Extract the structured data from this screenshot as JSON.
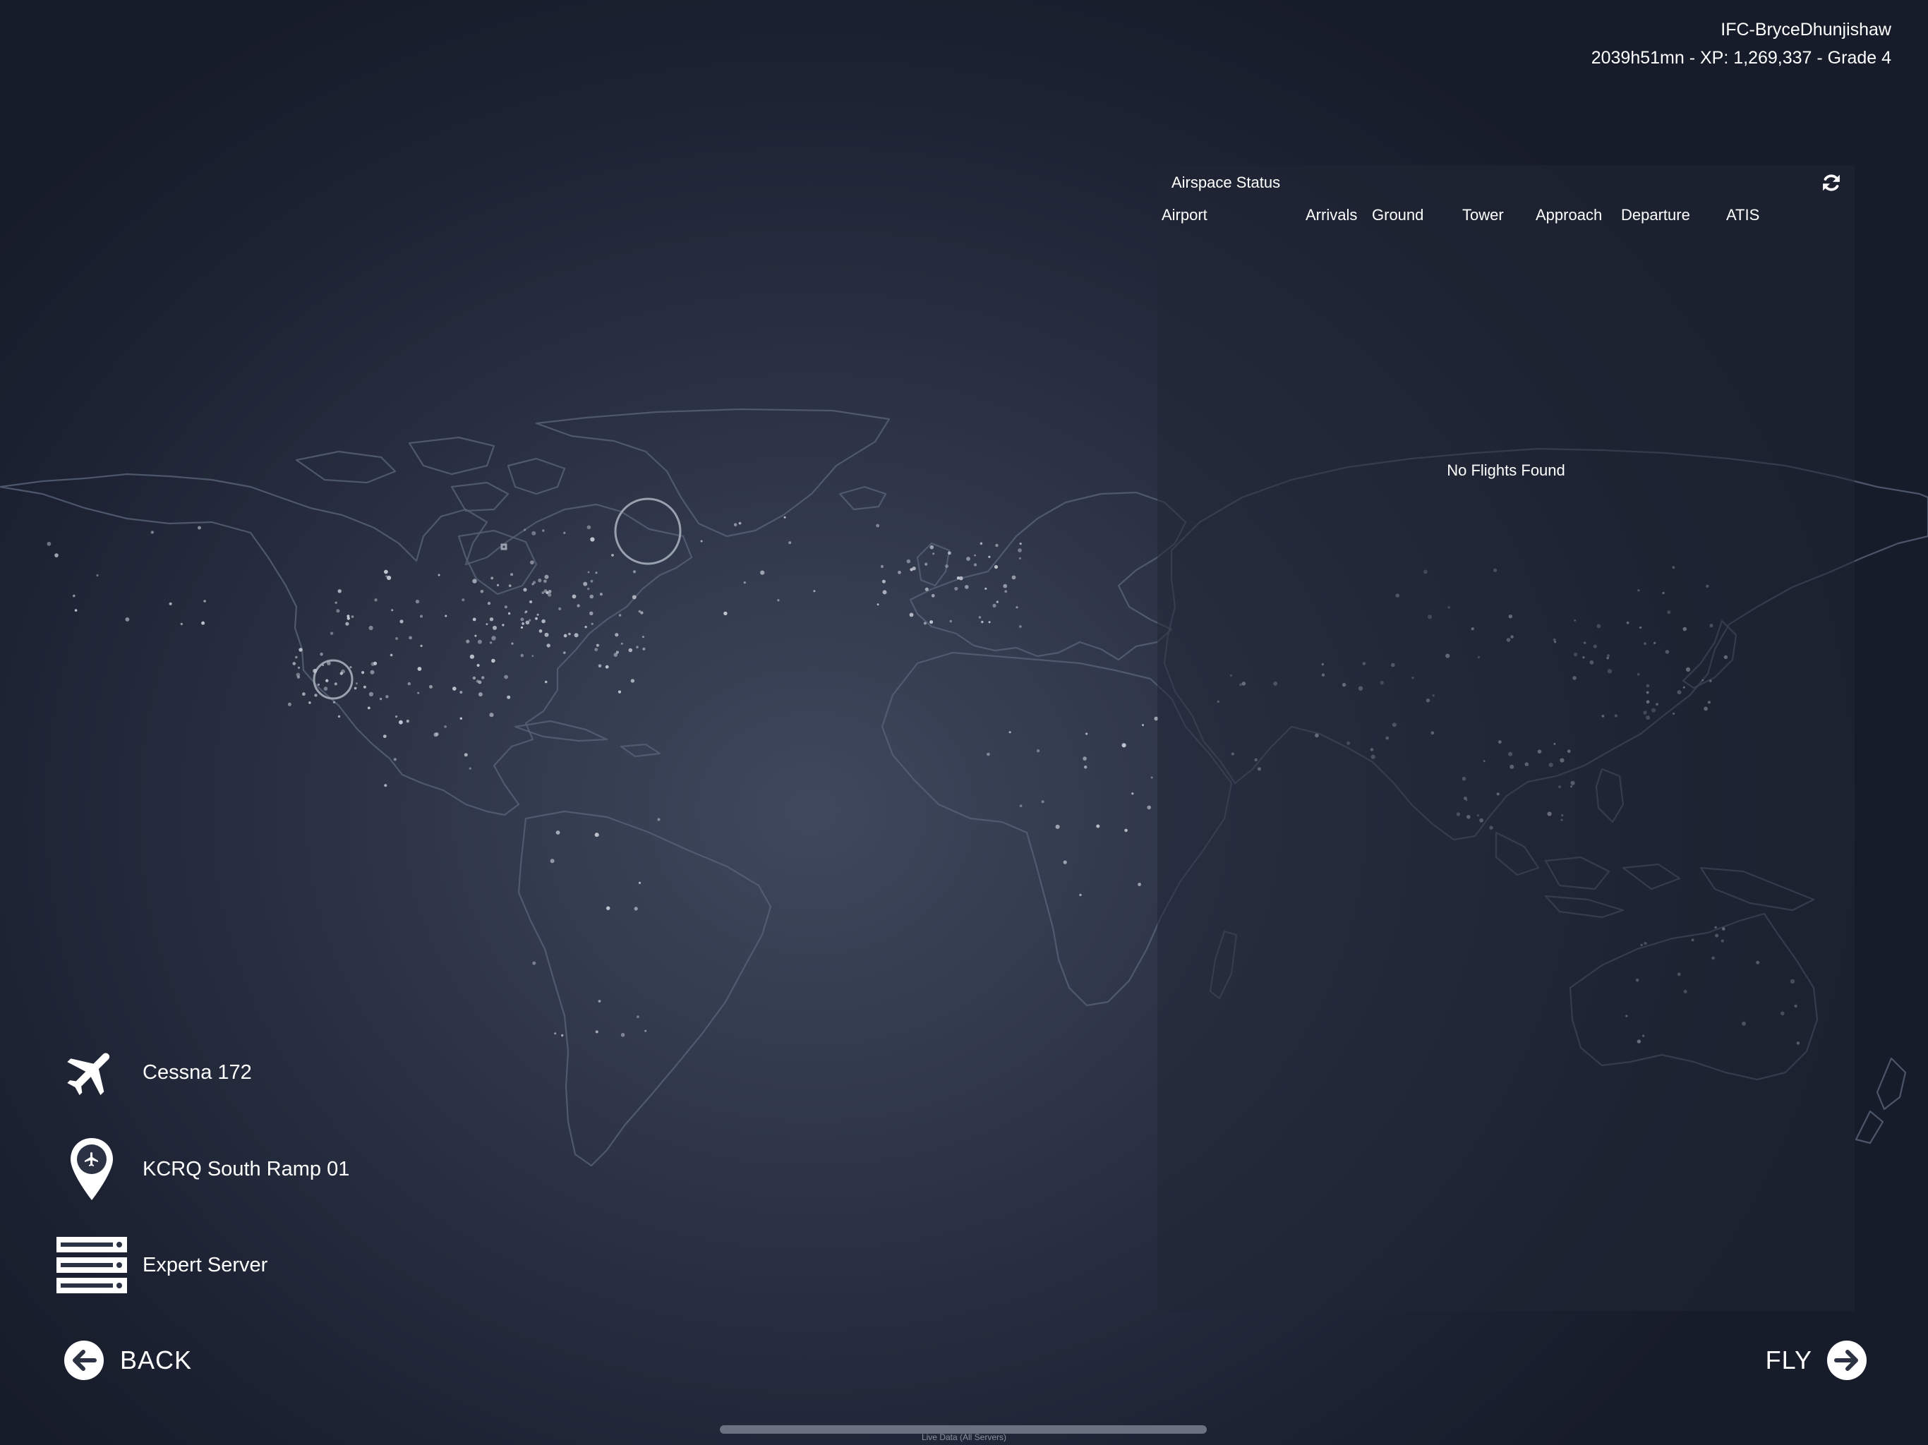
{
  "user": {
    "name": "IFC-BryceDhunjishaw",
    "stats": "2039h51mn - XP: 1,269,337 - Grade 4"
  },
  "airspace_panel": {
    "title": "Airspace Status",
    "columns": [
      "Airport",
      "Arrivals",
      "Ground",
      "Tower",
      "Approach",
      "Departure",
      "ATIS"
    ],
    "empty_message": "No Flights Found",
    "refresh_icon": "refresh-icon"
  },
  "selection": {
    "aircraft": {
      "label": "Cessna 172",
      "icon": "airplane-icon"
    },
    "location": {
      "label": "KCRQ South Ramp 01",
      "icon": "airport-pin-icon"
    },
    "server": {
      "label": "Expert Server",
      "icon": "server-icon"
    }
  },
  "nav": {
    "back_label": "BACK",
    "back_icon": "arrow-left-circle-icon",
    "fly_label": "FLY",
    "fly_icon": "arrow-right-circle-icon"
  },
  "footer": {
    "note": "Live Data (All Servers)"
  },
  "colors": {
    "background": "#2b3244",
    "panel": "#202634",
    "coastline": "#566075",
    "text": "#ffffff"
  }
}
